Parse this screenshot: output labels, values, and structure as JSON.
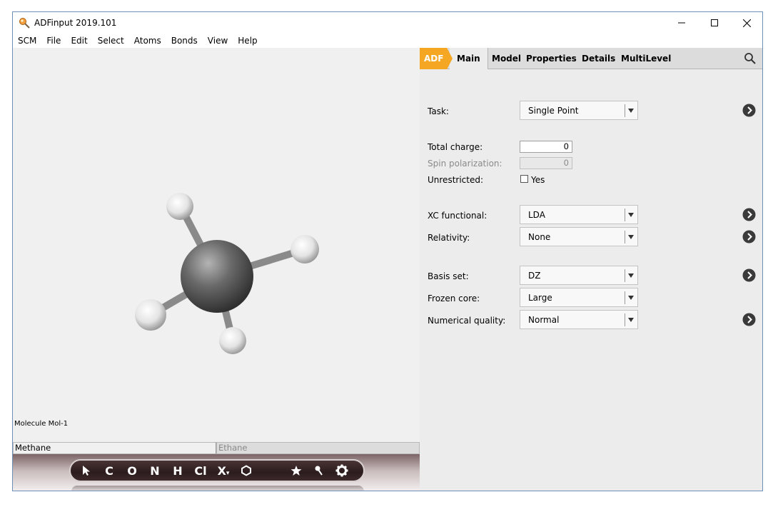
{
  "window": {
    "title": "ADFinput 2019.101"
  },
  "menu": [
    "SCM",
    "File",
    "Edit",
    "Select",
    "Atoms",
    "Bonds",
    "View",
    "Help"
  ],
  "viewer": {
    "molecule_label": "Molecule Mol-1",
    "molecule_tabs": [
      {
        "label": "Methane",
        "active": true
      },
      {
        "label": "Ethane",
        "active": false
      }
    ]
  },
  "toolbar": {
    "pointer_icon": "pointer-arrow-icon",
    "elements": [
      "C",
      "O",
      "N",
      "H",
      "Cl",
      "X"
    ],
    "x_suffix": "▾",
    "tools": [
      "hexagon-ring-icon",
      "star-icon",
      "pin-icon",
      "gear-icon"
    ]
  },
  "panel": {
    "breadcrumb_root": "ADF",
    "active_tab": "Main",
    "tabs": [
      "Model",
      "Properties",
      "Details",
      "MultiLevel"
    ],
    "accent_color": "#f5a623",
    "fields": {
      "task": {
        "label": "Task:",
        "value": "Single Point"
      },
      "total_charge": {
        "label": "Total charge:",
        "value": "0"
      },
      "spin_polarization": {
        "label": "Spin polarization:",
        "value": "0"
      },
      "unrestricted": {
        "label": "Unrestricted:",
        "option": "Yes",
        "checked": false
      },
      "xc_functional": {
        "label": "XC functional:",
        "value": "LDA"
      },
      "relativity": {
        "label": "Relativity:",
        "value": "None"
      },
      "basis_set": {
        "label": "Basis set:",
        "value": "DZ"
      },
      "frozen_core": {
        "label": "Frozen core:",
        "value": "Large"
      },
      "numerical_quality": {
        "label": "Numerical quality:",
        "value": "Normal"
      }
    }
  }
}
